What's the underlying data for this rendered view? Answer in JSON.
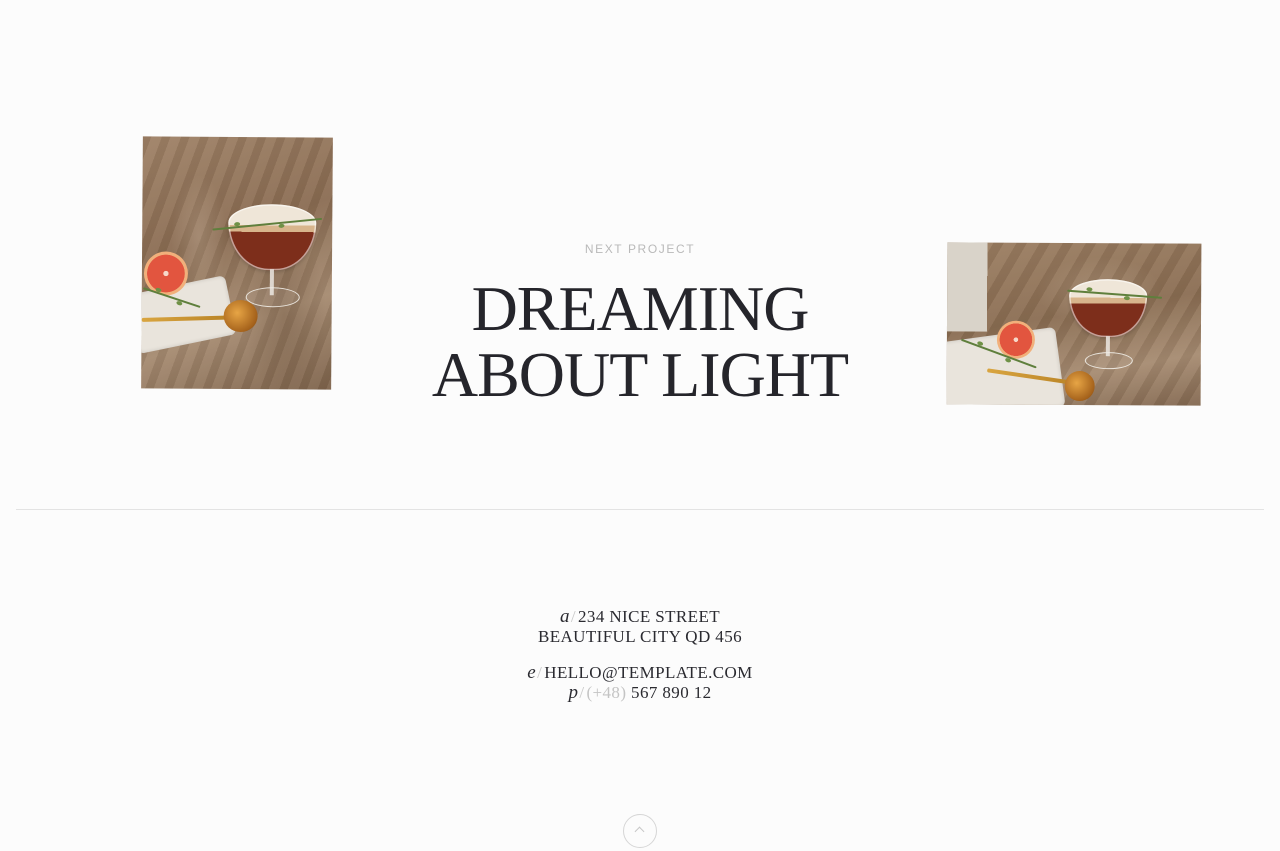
{
  "next_project": {
    "eyebrow": "NEXT PROJECT",
    "title_line_1": "DREAMING",
    "title_line_2": "ABOUT LIGHT"
  },
  "contact": {
    "address_prefix": "a",
    "address_line_1": "234 NICE STREET",
    "address_line_2": "BEAUTIFUL CITY QD 456",
    "email_prefix": "e",
    "email": "HELLO@TEMPLATE.COM",
    "phone_prefix": "p",
    "phone_code": "(+48)",
    "phone_number": "567 890 12"
  },
  "icons": {
    "back_to_top": "chevron-up-icon"
  },
  "colors": {
    "background": "#fcfcfc",
    "text": "#25252b",
    "muted": "#b9b9b9",
    "divider": "#e3e3e3"
  }
}
